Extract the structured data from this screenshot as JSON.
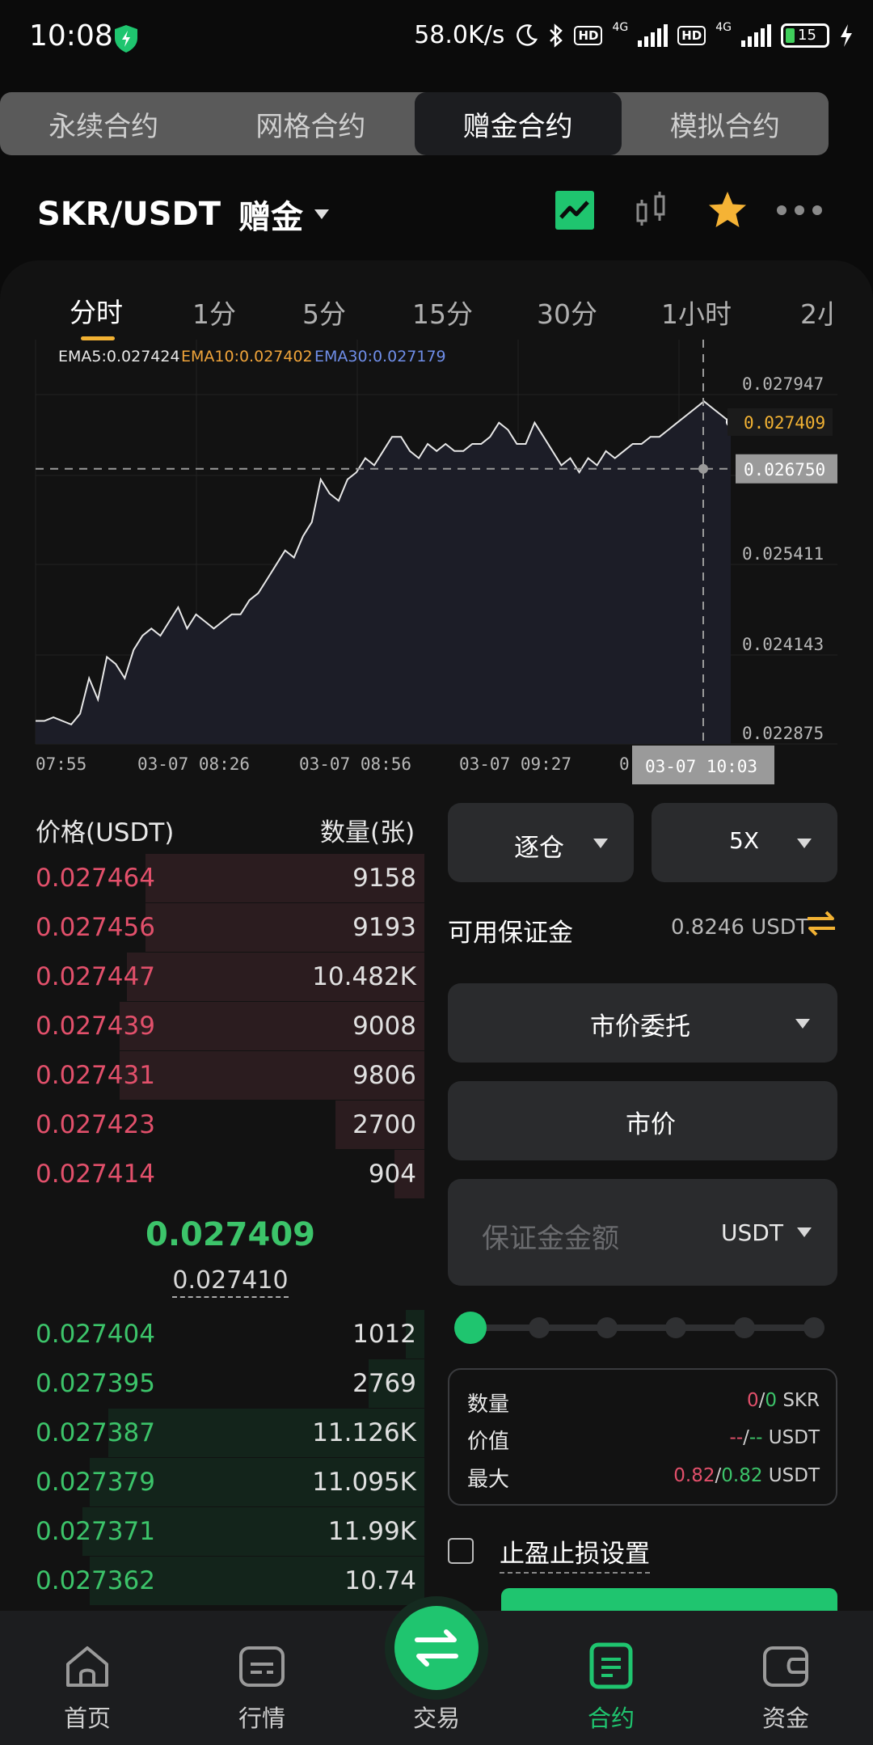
{
  "status_bar": {
    "time": "10:08",
    "net_speed": "58.0K/s",
    "battery": "15",
    "signal_label": "4G",
    "hd_label": "HD"
  },
  "top_tabs": [
    {
      "label": "永续合约",
      "active": false
    },
    {
      "label": "网格合约",
      "active": false
    },
    {
      "label": "赠金合约",
      "active": true
    },
    {
      "label": "模拟合约",
      "active": false
    }
  ],
  "header": {
    "pair": "SKR/USDT",
    "tag": "赠金",
    "icons": [
      "line-chart-icon",
      "candlestick-icon",
      "star-icon",
      "more-icon"
    ]
  },
  "chart_tabs": [
    "分时",
    "1分",
    "5分",
    "15分",
    "30分",
    "1小时",
    "2小"
  ],
  "chart_data": {
    "type": "area",
    "ema_legend": [
      {
        "label": "EMA5:0.027424",
        "color": "#e8e8e8"
      },
      {
        "label": "EMA10:0.027402",
        "color": "#f0a43a"
      },
      {
        "label": "EMA30:0.027179",
        "color": "#6f8ee8"
      }
    ],
    "y_ticks": [
      "0.027947",
      "0.025411",
      "0.024143",
      "0.022875"
    ],
    "last_price_tag": "0.027409",
    "crosshair_price": "0.026750",
    "crosshair_time": "03-07 10:03",
    "x_ticks": [
      "07:55",
      "03-07 08:26",
      "03-07 08:56",
      "03-07 09:27",
      "0"
    ],
    "ylim": [
      0.022875,
      0.028
    ],
    "values": [
      0.0232,
      0.0232,
      0.02325,
      0.0232,
      0.02315,
      0.0233,
      0.0238,
      0.0235,
      0.0241,
      0.024,
      0.0238,
      0.0242,
      0.0244,
      0.0245,
      0.0244,
      0.0246,
      0.0248,
      0.0245,
      0.0247,
      0.0246,
      0.0245,
      0.0246,
      0.0247,
      0.0247,
      0.0249,
      0.025,
      0.0252,
      0.0254,
      0.0256,
      0.0255,
      0.0258,
      0.026,
      0.0266,
      0.0264,
      0.0263,
      0.0266,
      0.0267,
      0.0269,
      0.0268,
      0.027,
      0.0272,
      0.0272,
      0.027,
      0.0269,
      0.0271,
      0.027,
      0.0271,
      0.027,
      0.027,
      0.0271,
      0.0271,
      0.0272,
      0.0274,
      0.0273,
      0.0271,
      0.0271,
      0.0274,
      0.0272,
      0.027,
      0.0268,
      0.0269,
      0.0267,
      0.0269,
      0.0268,
      0.027,
      0.0269,
      0.027,
      0.0271,
      0.0271,
      0.0272,
      0.0272,
      0.0273,
      0.0274,
      0.0275,
      0.0276,
      0.0277,
      0.0276,
      0.0275,
      0.0274
    ]
  },
  "order_book": {
    "price_header": "价格(USDT)",
    "qty_header": "数量(张)",
    "asks": [
      {
        "price": "0.027464",
        "qty": "9158",
        "depth": 0.75
      },
      {
        "price": "0.027456",
        "qty": "9193",
        "depth": 0.75
      },
      {
        "price": "0.027447",
        "qty": "10.482K",
        "depth": 0.8
      },
      {
        "price": "0.027439",
        "qty": "9008",
        "depth": 0.82
      },
      {
        "price": "0.027431",
        "qty": "9806",
        "depth": 0.82
      },
      {
        "price": "0.027423",
        "qty": "2700",
        "depth": 0.24
      },
      {
        "price": "0.027414",
        "qty": "904",
        "depth": 0.08
      }
    ],
    "last_price": "0.027409",
    "mark_price": "0.027410",
    "bids": [
      {
        "price": "0.027404",
        "qty": "1012",
        "depth": 0.05
      },
      {
        "price": "0.027395",
        "qty": "2769",
        "depth": 0.15
      },
      {
        "price": "0.027387",
        "qty": "11.126K",
        "depth": 0.85
      },
      {
        "price": "0.027379",
        "qty": "11.095K",
        "depth": 0.9
      },
      {
        "price": "0.027371",
        "qty": "11.99K",
        "depth": 0.92
      },
      {
        "price": "0.027362",
        "qty": "10.74",
        "depth": 0.9
      }
    ]
  },
  "trade_form": {
    "margin_mode": "逐仓",
    "leverage": "5X",
    "available_label": "可用保证金",
    "available_value": "0.8246 USDT",
    "order_type": "市价委托",
    "price_mode": "市价",
    "amount_placeholder": "保证金金额",
    "amount_unit": "USDT",
    "slider_position": 0,
    "info": [
      {
        "label": "数量",
        "red": "0",
        "sep": "/",
        "green": "0",
        "unit": "SKR"
      },
      {
        "label": "价值",
        "red": "--",
        "sep": "/",
        "green": "--",
        "unit": "USDT"
      },
      {
        "label": "最大",
        "red": "0.82",
        "sep": "/",
        "green": "0.82",
        "unit": "USDT"
      }
    ],
    "tpsl_label": "止盈止损设置"
  },
  "bottom_nav": [
    {
      "label": "首页",
      "icon": "home-icon",
      "active": false
    },
    {
      "label": "行情",
      "icon": "market-icon",
      "active": false
    },
    {
      "label": "交易",
      "icon": "swap-icon",
      "active": false
    },
    {
      "label": "合约",
      "icon": "contract-icon",
      "active": true
    },
    {
      "label": "资金",
      "icon": "wallet-icon",
      "active": false
    }
  ],
  "colors": {
    "up": "#3cc46a",
    "down": "#e2506b",
    "accent": "#1fc56f",
    "star": "#f5b335"
  }
}
